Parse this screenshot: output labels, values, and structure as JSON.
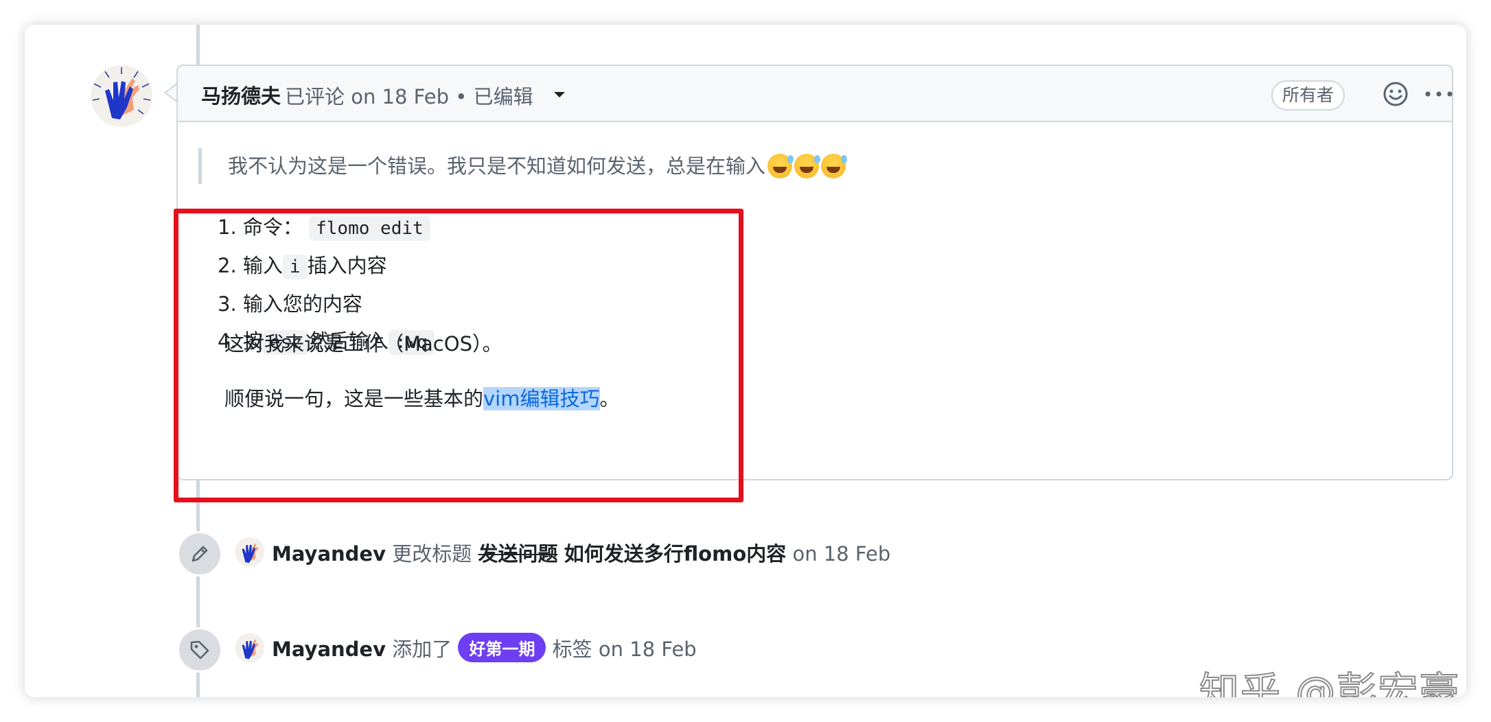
{
  "comment": {
    "author": "马扬德夫",
    "meta": "已评论 on 18 Feb • 已编辑",
    "owner_badge": "所有者",
    "quote_text": "我不认为这是一个错误。我只是不知道如何发送，总是在输入",
    "steps": [
      {
        "num": "1.",
        "pre": "命令：",
        "code": "flomo edit",
        "post": ""
      },
      {
        "num": "2.",
        "pre": "输入",
        "code": "i",
        "post": "插入内容"
      },
      {
        "num": "3.",
        "pre": "输入您的内容",
        "code": "",
        "post": ""
      },
      {
        "num": "4.",
        "pre": "按",
        "code": "esc",
        "post": "然后输入",
        "code2": ":wq"
      }
    ],
    "para1": "这对我来说是工作（MacOS）。",
    "para2_prefix": "顺便说一句，这是一些基本的",
    "para2_link": "vim编辑技巧",
    "para2_suffix": "。"
  },
  "events": [
    {
      "user": "Mayandev",
      "action": "更改标题",
      "old_title": "发送问题",
      "new_title": "如何发送多行flomo内容",
      "time": "on 18 Feb"
    },
    {
      "user": "Mayandev",
      "action": "添加了",
      "label": "好第一期",
      "suffix": "标签",
      "time": "on 18 Feb"
    }
  ],
  "watermark": "知乎 @彭宏豪",
  "icons": [
    "smiley-icon",
    "kebab-more-icon",
    "pencil-icon",
    "tag-icon",
    "caret-down-icon"
  ],
  "colors": {
    "highlight_box": "#e3101d",
    "label_bg": "#6e3ef2",
    "link": "#0969da"
  }
}
